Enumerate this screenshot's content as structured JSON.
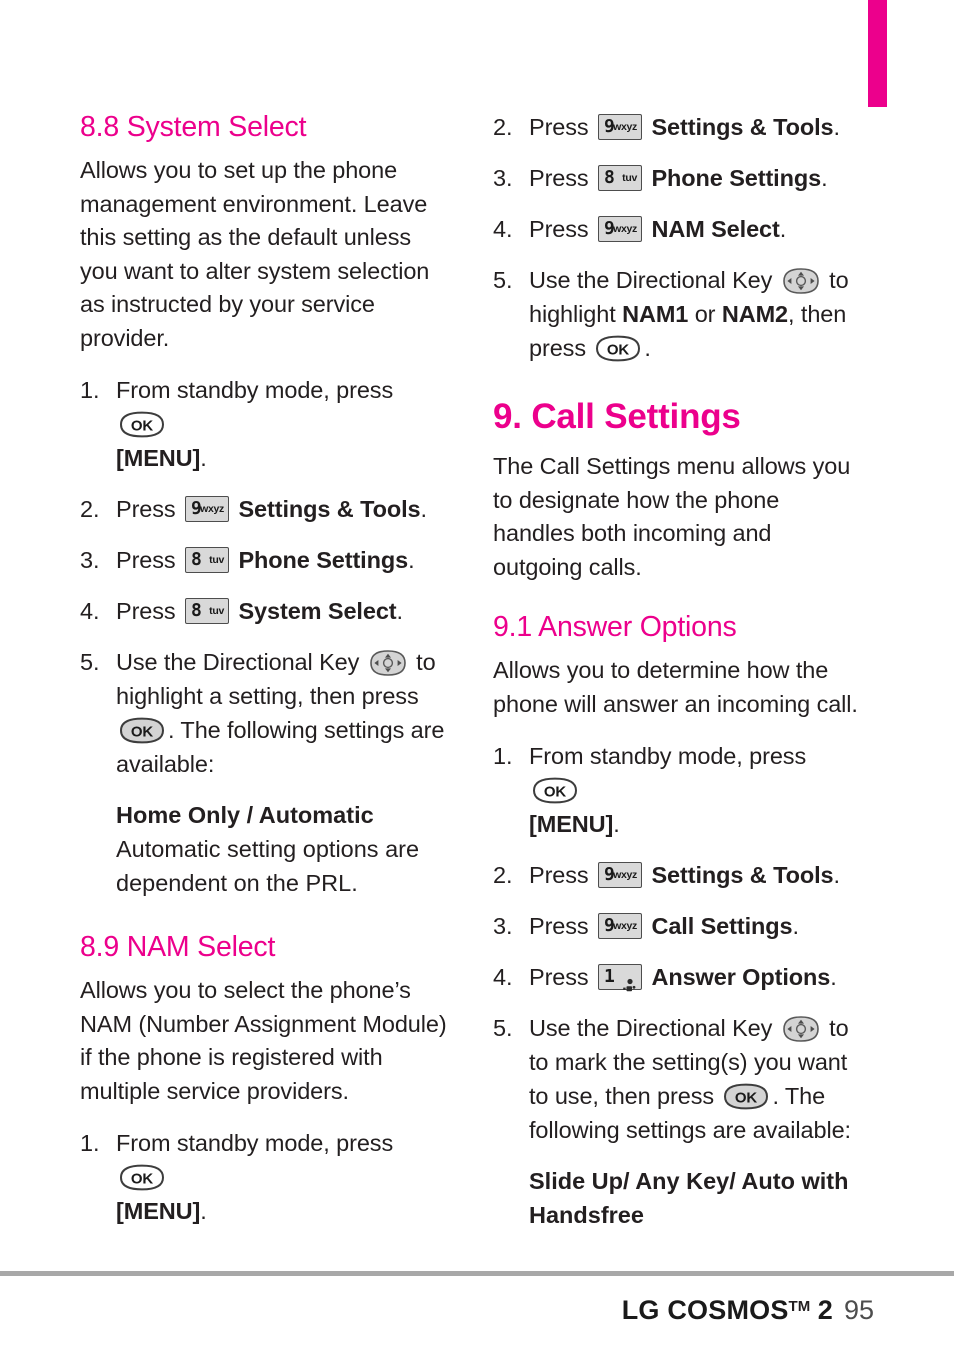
{
  "page": {
    "tab_marker_color": "#ec008c",
    "heading_color": "#ec008c",
    "footer": {
      "brand": "LG COSMOS",
      "tm": "TM",
      "model": "2",
      "page_number": "95"
    }
  },
  "left_column": {
    "section_8_8": {
      "heading": "8.8 System Select",
      "intro": "Allows you to set up the phone management environment. Leave this setting as the default unless you want to alter system selection as instructed by your service provider.",
      "steps": [
        {
          "num": "1.",
          "pre": "From standby mode, press",
          "key": "ok",
          "post": "",
          "bold_after": "[MENU]",
          "tail": "."
        },
        {
          "num": "2.",
          "pre": "Press",
          "key": "9wxyz",
          "bold_after": "Settings & Tools",
          "tail": "."
        },
        {
          "num": "3.",
          "pre": "Press",
          "key": "8tuv",
          "bold_after": "Phone Settings",
          "tail": "."
        },
        {
          "num": "4.",
          "pre": "Press",
          "key": "8tuv",
          "bold_after": "System Select",
          "tail": "."
        },
        {
          "num": "5.",
          "pre": "Use the Directional Key",
          "key": "directional",
          "mid": "to highlight a setting, then press",
          "key2": "ok",
          "tail": ". The following settings are available:"
        }
      ],
      "option_title": "Home Only / Automatic",
      "option_desc": "Automatic setting options are dependent on the PRL."
    },
    "section_8_9": {
      "heading": "8.9 NAM Select",
      "intro": "Allows you to select the phone’s NAM (Number Assignment Module) if the phone is registered with multiple service providers.",
      "steps": [
        {
          "num": "1.",
          "pre": "From standby mode, press",
          "key": "ok",
          "bold_after": "[MENU]",
          "tail": "."
        }
      ]
    }
  },
  "right_column": {
    "section_8_9_cont": {
      "steps": [
        {
          "num": "2.",
          "pre": "Press",
          "key": "9wxyz",
          "bold_after": "Settings & Tools",
          "tail": "."
        },
        {
          "num": "3.",
          "pre": "Press",
          "key": "8tuv",
          "bold_after": "Phone Settings",
          "tail": "."
        },
        {
          "num": "4.",
          "pre": "Press",
          "key": "9wxyz",
          "bold_after": "NAM Select",
          "tail": "."
        },
        {
          "num": "5.",
          "pre": "Use the Directional Key",
          "key": "directional",
          "mid_a": "to highlight",
          "bold_a": "NAM1",
          "mid_b": "or",
          "bold_b": "NAM2",
          "mid_c": ", then press",
          "key2": "ok",
          "tail": "."
        }
      ]
    },
    "section_9": {
      "heading": "9. Call Settings",
      "intro": "The Call Settings menu allows you to designate how the phone handles both incoming and outgoing calls."
    },
    "section_9_1": {
      "heading": "9.1 Answer Options",
      "intro": "Allows you to determine how the phone will answer an incoming call.",
      "steps": [
        {
          "num": "1.",
          "pre": "From standby mode, press",
          "key": "ok",
          "bold_after": "[MENU]",
          "tail": "."
        },
        {
          "num": "2.",
          "pre": "Press",
          "key": "9wxyz",
          "bold_after": "Settings & Tools",
          "tail": "."
        },
        {
          "num": "3.",
          "pre": "Press",
          "key": "9wxyz",
          "bold_after": "Call Settings",
          "tail": "."
        },
        {
          "num": "4.",
          "pre": "Press",
          "key": "1vm",
          "bold_after": "Answer Options",
          "tail": "."
        },
        {
          "num": "5.",
          "pre": "Use the Directional Key",
          "key": "directional",
          "mid": "to to mark the setting(s) you want to use, then press",
          "key2": "ok",
          "tail": ". The following settings are available:"
        }
      ],
      "option_title": "Slide Up/ Any Key/ Auto with Handsfree"
    }
  },
  "keys": {
    "ok": {
      "label": "OK",
      "name": "ok-key-icon"
    },
    "9wxyz": {
      "digit": "9",
      "letters": "wxyz",
      "name": "key-9-wxyz-icon"
    },
    "8tuv": {
      "digit": "8",
      "letters": "tuv",
      "name": "key-8-tuv-icon"
    },
    "1vm": {
      "digit": "1",
      "letters": "",
      "name": "key-1-voicemail-icon"
    },
    "directional": {
      "name": "directional-key-icon"
    }
  }
}
